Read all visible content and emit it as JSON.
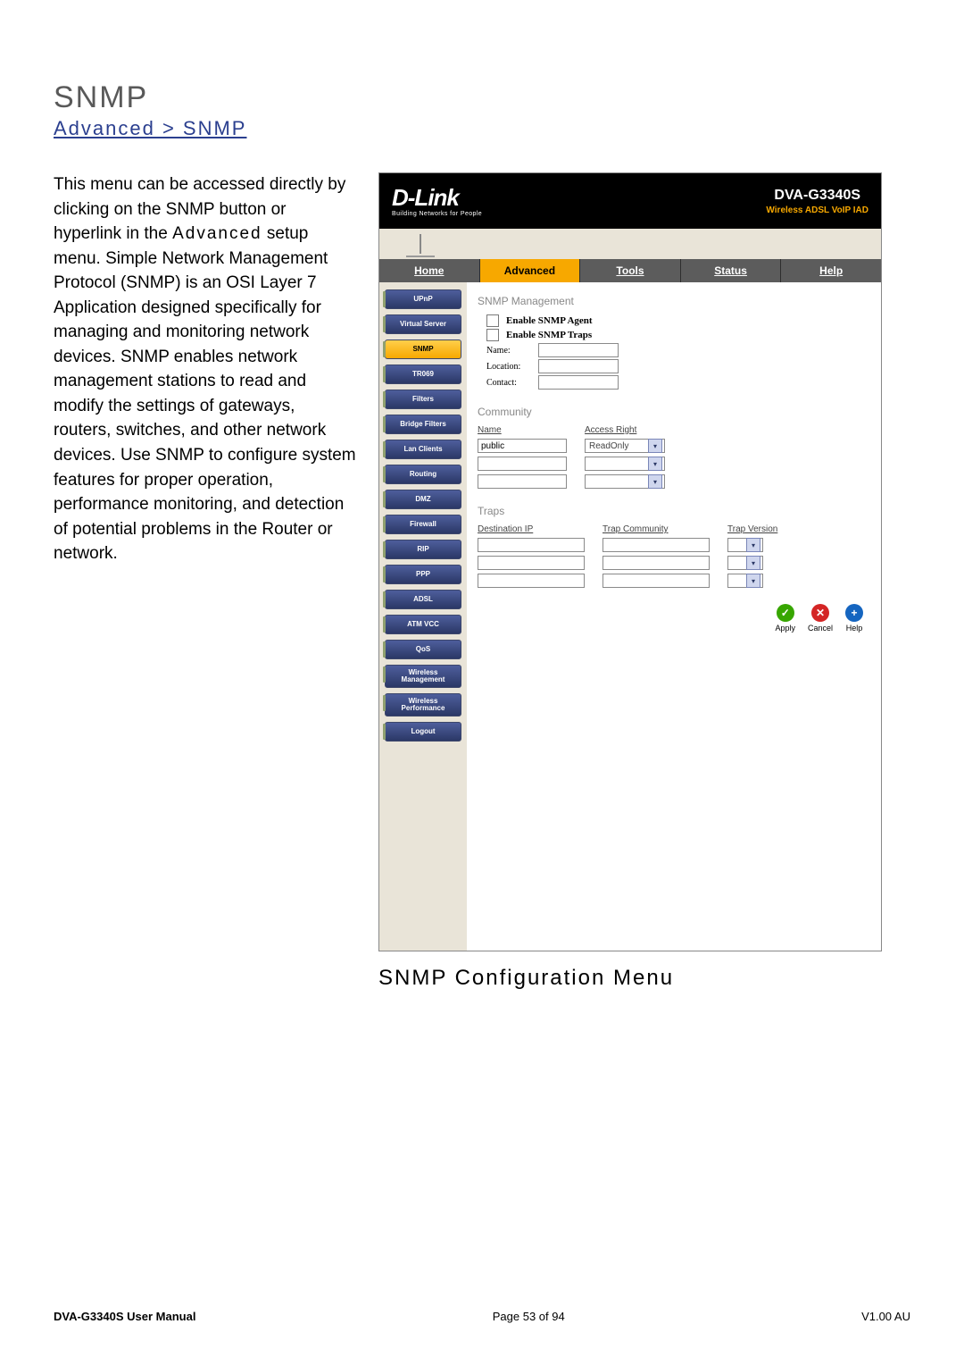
{
  "page": {
    "title": "SNMP",
    "breadcrumb": "Advanced > SNMP",
    "description_parts": {
      "p1a": "This menu can be accessed directly by clicking on the SNMP button or hyperlink in the ",
      "p1_menu": "Advanced",
      "p1b": " setup menu. Simple Network Management Protocol (SNMP) is an OSI Layer 7 Application designed specifically for managing and monitoring network devices. SNMP enables network management stations to read and modify the settings of gateways, routers, switches, and other network devices. Use SNMP to configure system features for proper operation, performance monitoring, and detection of potential problems in the Router or network."
    },
    "caption": "SNMP Configuration Menu"
  },
  "router": {
    "logo": {
      "brand": "D-Link",
      "tagline": "Building Networks for People"
    },
    "product": {
      "model": "DVA-G3340S",
      "tagline": "Wireless ADSL VoIP IAD"
    },
    "tabs": [
      {
        "label": "Home",
        "active": false
      },
      {
        "label": "Advanced",
        "active": true
      },
      {
        "label": "Tools",
        "active": false
      },
      {
        "label": "Status",
        "active": false
      },
      {
        "label": "Help",
        "active": false
      }
    ],
    "sidebar": [
      {
        "label": "UPnP",
        "active": false
      },
      {
        "label": "Virtual Server",
        "active": false
      },
      {
        "label": "SNMP",
        "active": true
      },
      {
        "label": "TR069",
        "active": false
      },
      {
        "label": "Filters",
        "active": false
      },
      {
        "label": "Bridge Filters",
        "active": false
      },
      {
        "label": "Lan Clients",
        "active": false
      },
      {
        "label": "Routing",
        "active": false
      },
      {
        "label": "DMZ",
        "active": false
      },
      {
        "label": "Firewall",
        "active": false
      },
      {
        "label": "RIP",
        "active": false
      },
      {
        "label": "PPP",
        "active": false
      },
      {
        "label": "ADSL",
        "active": false
      },
      {
        "label": "ATM VCC",
        "active": false
      },
      {
        "label": "QoS",
        "active": false
      },
      {
        "label": "Wireless Management",
        "active": false,
        "tall": true
      },
      {
        "label": "Wireless Performance",
        "active": false,
        "tall": true
      },
      {
        "label": "Logout",
        "active": false
      }
    ],
    "content": {
      "section_mgmt": "SNMP Management",
      "enable_agent": "Enable SNMP Agent",
      "enable_traps": "Enable SNMP Traps",
      "name_label": "Name:",
      "location_label": "Location:",
      "contact_label": "Contact:",
      "name_value": "",
      "location_value": "",
      "contact_value": "",
      "section_community": "Community",
      "community_headers": {
        "name": "Name",
        "access": "Access Right"
      },
      "community_rows": [
        {
          "name": "public",
          "access": "ReadOnly"
        },
        {
          "name": "",
          "access": ""
        },
        {
          "name": "",
          "access": ""
        }
      ],
      "section_traps": "Traps",
      "traps_headers": {
        "dest": "Destination IP",
        "comm": "Trap Community",
        "ver": "Trap Version"
      },
      "traps_rows": [
        {
          "dest": "",
          "comm": "",
          "ver": ""
        },
        {
          "dest": "",
          "comm": "",
          "ver": ""
        },
        {
          "dest": "",
          "comm": "",
          "ver": ""
        }
      ],
      "actions": {
        "apply": "Apply",
        "cancel": "Cancel",
        "help": "Help"
      },
      "icons": {
        "apply_glyph": "✓",
        "cancel_glyph": "✕",
        "help_glyph": "+"
      }
    }
  },
  "footer": {
    "left": "DVA-G3340S User Manual",
    "center": "Page 53 of 94",
    "right": "V1.00 AU"
  }
}
